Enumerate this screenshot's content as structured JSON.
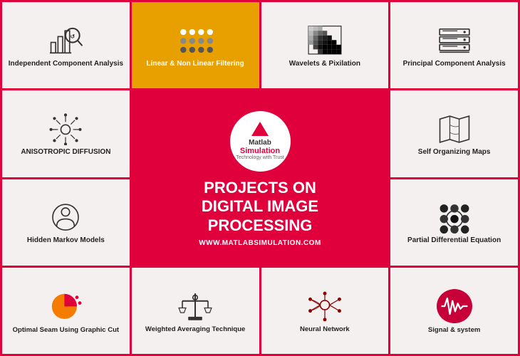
{
  "cells": [
    {
      "id": "independent-component-analysis",
      "label": "Independent Component Analysis",
      "icon": "ica",
      "highlighted": false,
      "row": 1,
      "col": 1
    },
    {
      "id": "linear-non-linear-filtering",
      "label": "Linear & Non Linear Filtering",
      "icon": "dots",
      "highlighted": true,
      "row": 1,
      "col": 2
    },
    {
      "id": "wavelets-pixilation",
      "label": "Wavelets & Pixilation",
      "icon": "wavelets",
      "highlighted": false,
      "row": 1,
      "col": 3
    },
    {
      "id": "principal-component-analysis",
      "label": "Principal Component Analysis",
      "icon": "pca",
      "highlighted": false,
      "row": 1,
      "col": 4
    },
    {
      "id": "anisotropic-diffusion",
      "label": "ANISOTROPIC DIFFUSION",
      "icon": "aniso",
      "highlighted": false,
      "row": 2,
      "col": 1
    },
    {
      "id": "self-organizing-maps",
      "label": "Self Organizing Maps",
      "icon": "som",
      "highlighted": false,
      "row": 2,
      "col": 4
    },
    {
      "id": "hidden-markov-models",
      "label": "Hidden Markov Models",
      "icon": "hmm",
      "highlighted": false,
      "row": 3,
      "col": 1
    },
    {
      "id": "partial-differential-equation",
      "label": "Partial Differential Equation",
      "icon": "pde",
      "highlighted": false,
      "row": 3,
      "col": 4
    },
    {
      "id": "optimal-seam-graphic-cut",
      "label": "Optimal Seam Using Graphic Cut",
      "icon": "pie",
      "highlighted": false,
      "row": 4,
      "col": 1
    },
    {
      "id": "weighted-averaging-technique",
      "label": "Weighted Averaging Technique",
      "icon": "wat",
      "highlighted": false,
      "row": 4,
      "col": 2
    },
    {
      "id": "neural-network",
      "label": "Neural Network",
      "icon": "nn",
      "highlighted": false,
      "row": 4,
      "col": 3
    },
    {
      "id": "signal-system",
      "label": "Signal & system",
      "icon": "signal",
      "highlighted": false,
      "row": 4,
      "col": 4
    }
  ],
  "center": {
    "logo_text": "Matlab",
    "logo_simulation": "Simulation",
    "logo_tagline": "Technology with Trust",
    "title": "PROJECTS ON\nDIGITAL IMAGE\nPROCESSING",
    "url": "WWW.MATLABSIMULATION.COM"
  }
}
